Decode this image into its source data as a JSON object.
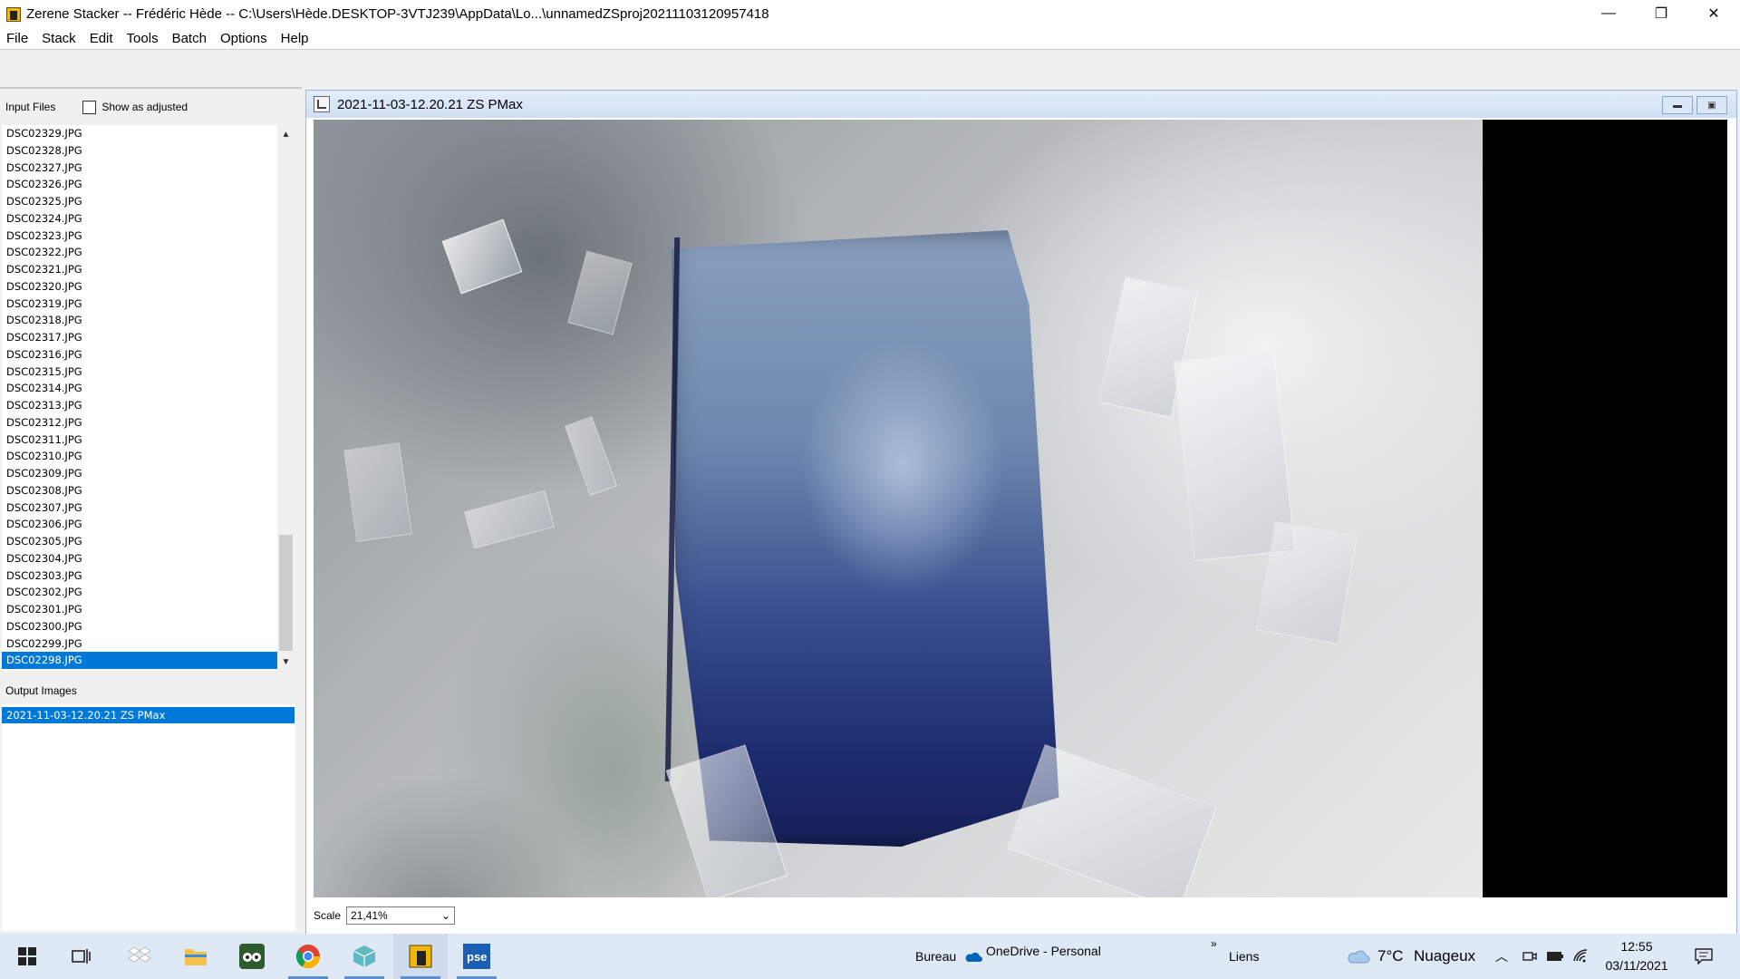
{
  "window": {
    "title": "Zerene Stacker -- Frédéric Hède -- C:\\Users\\Hède.DESKTOP-3VTJ239\\AppData\\Lo...\\unnamedZSproj20211103120957418",
    "minimize": "—",
    "restore": "❐",
    "close": "✕"
  },
  "menu": [
    "File",
    "Stack",
    "Edit",
    "Tools",
    "Batch",
    "Options",
    "Help"
  ],
  "input_files": {
    "header": "Input Files",
    "show_adjusted_label": "Show as adjusted",
    "files": [
      "DSC02329.JPG",
      "DSC02328.JPG",
      "DSC02327.JPG",
      "DSC02326.JPG",
      "DSC02325.JPG",
      "DSC02324.JPG",
      "DSC02323.JPG",
      "DSC02322.JPG",
      "DSC02321.JPG",
      "DSC02320.JPG",
      "DSC02319.JPG",
      "DSC02318.JPG",
      "DSC02317.JPG",
      "DSC02316.JPG",
      "DSC02315.JPG",
      "DSC02314.JPG",
      "DSC02313.JPG",
      "DSC02312.JPG",
      "DSC02311.JPG",
      "DSC02310.JPG",
      "DSC02309.JPG",
      "DSC02308.JPG",
      "DSC02307.JPG",
      "DSC02306.JPG",
      "DSC02305.JPG",
      "DSC02304.JPG",
      "DSC02303.JPG",
      "DSC02302.JPG",
      "DSC02301.JPG",
      "DSC02300.JPG",
      "DSC02299.JPG",
      "DSC02298.JPG"
    ],
    "selected": "DSC02298.JPG"
  },
  "output_images": {
    "header": "Output Images",
    "items": [
      "2021-11-03-12.20.21 ZS PMax"
    ]
  },
  "image_window": {
    "title": "2021-11-03-12.20.21 ZS PMax",
    "scale_label": "Scale",
    "scale_value": "21,41%"
  },
  "taskbar": {
    "bureau": "Bureau",
    "onedrive": "OneDrive - Personal",
    "liens": "Liens",
    "chevron": "»",
    "weather_temp": "7°C",
    "weather_desc": "Nuageux",
    "time": "12:55",
    "date": "03/11/2021"
  },
  "colors": {
    "selection": "#0078d7",
    "taskbar": "#dfe9f5"
  }
}
